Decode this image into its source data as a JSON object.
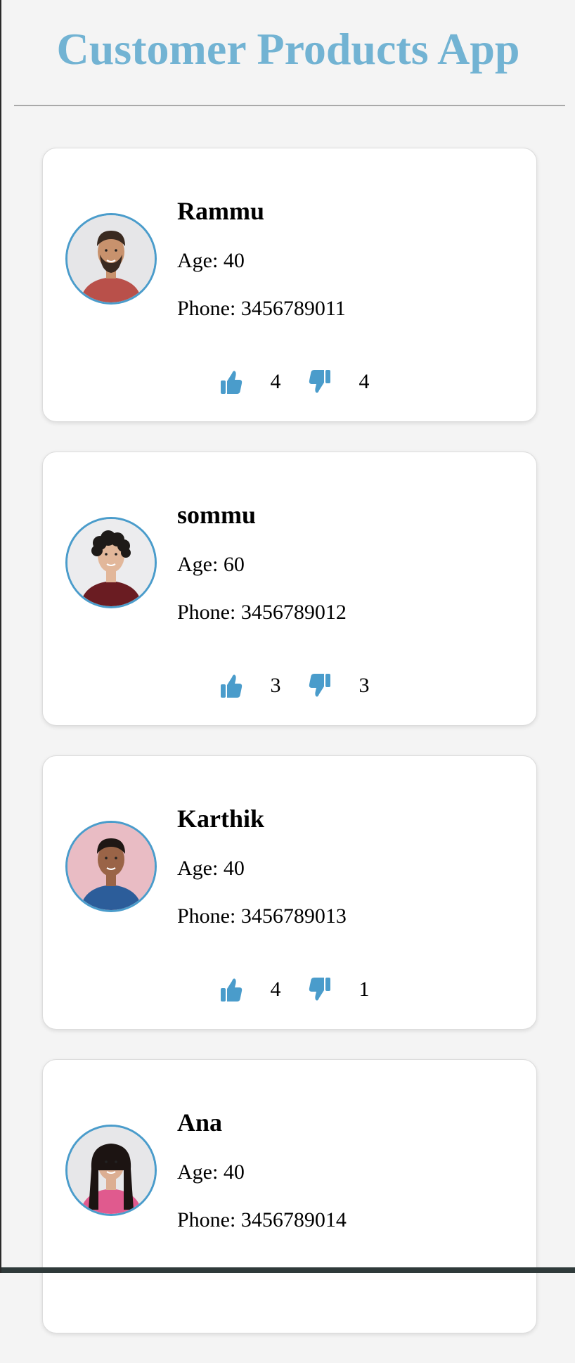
{
  "app": {
    "title": "Customer Products App"
  },
  "colors": {
    "title": "#72b3d3",
    "accent": "#4a9ccb",
    "card_background": "#ffffff",
    "page_background": "#f4f4f4"
  },
  "customers": [
    {
      "name": "Rammu",
      "age_text": "Age: 40",
      "phone_text": "Phone: 3456789011",
      "likes": "4",
      "dislikes": "4",
      "avatar": {
        "icon": "man-beard-plaid-shirt",
        "bg": "#e6e6e8",
        "skin": "#c8926d",
        "hair": "#3a2a20",
        "shirt": "#b9504a"
      }
    },
    {
      "name": "sommu",
      "age_text": "Age: 60",
      "phone_text": "Phone: 3456789012",
      "likes": "3",
      "dislikes": "3",
      "avatar": {
        "icon": "man-curly-hair-red-shirt",
        "bg": "#ececee",
        "skin": "#e2b79a",
        "hair": "#1e1a18",
        "shirt": "#6a1c22"
      }
    },
    {
      "name": "Karthik",
      "age_text": "Age: 40",
      "phone_text": "Phone: 3456789013",
      "likes": "4",
      "dislikes": "1",
      "avatar": {
        "icon": "man-blue-jacket",
        "bg": "#e9bcc4",
        "skin": "#9a6447",
        "hair": "#1f1714",
        "shirt": "#2c5d9a"
      }
    },
    {
      "name": "Ana",
      "age_text": "Age: 40",
      "phone_text": "Phone: 3456789014",
      "likes": "",
      "dislikes": "",
      "avatar": {
        "icon": "woman-long-hair-pink-sweater",
        "bg": "#e7e7e9",
        "skin": "#dcae92",
        "hair": "#1c1412",
        "shirt": "#e05a8e"
      }
    }
  ],
  "icons": {
    "like": "thumbs-up-icon",
    "dislike": "thumbs-down-icon"
  }
}
